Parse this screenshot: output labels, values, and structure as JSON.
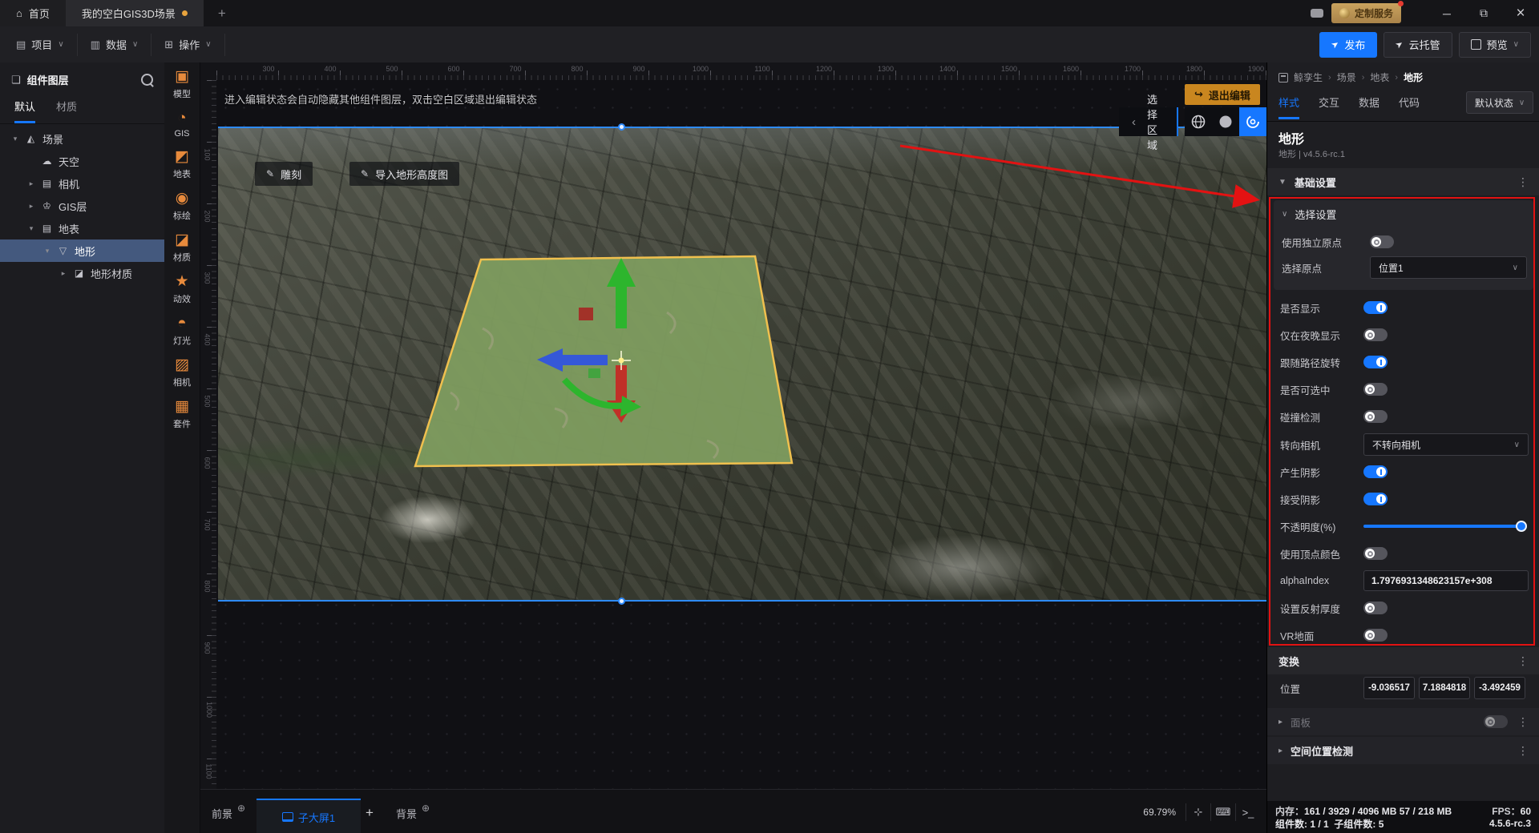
{
  "colors": {
    "accent": "#1677ff",
    "dock_icon": "#e78a3c",
    "annotation": "#e31212",
    "exit_button": "#c9861f",
    "tab_dot": "#e8a33d"
  },
  "titlebar": {
    "home_tab": "首页",
    "doc_tab": "我的空白GIS3D场景",
    "add_tab": "+",
    "service_badge": "定制服务",
    "minimize": "─",
    "restore": "⧉",
    "close": "×"
  },
  "menubar": {
    "items": [
      {
        "name": "project",
        "label": "项目"
      },
      {
        "name": "data",
        "label": "数据"
      },
      {
        "name": "operate",
        "label": "操作"
      }
    ],
    "publish": "发布",
    "cloud_host": "云托管",
    "preview": "预览"
  },
  "sidebar": {
    "title": "组件图层",
    "tabs": [
      {
        "name": "default",
        "label": "默认",
        "active": true
      },
      {
        "name": "material",
        "label": "材质",
        "active": false
      }
    ],
    "tree": [
      {
        "name": "scene",
        "label": "场景",
        "icon": "scene",
        "caret": "open",
        "indent": 0,
        "selected": false
      },
      {
        "name": "sky",
        "label": "天空",
        "icon": "sky",
        "caret": "",
        "indent": 1,
        "selected": false
      },
      {
        "name": "camera",
        "label": "相机",
        "icon": "folder",
        "caret": "closed",
        "indent": 1,
        "selected": false
      },
      {
        "name": "gis-layer",
        "label": "GIS层",
        "icon": "gis",
        "caret": "closed",
        "indent": 1,
        "selected": false
      },
      {
        "name": "ground",
        "label": "地表",
        "icon": "folder",
        "caret": "open",
        "indent": 1,
        "selected": false
      },
      {
        "name": "terrain",
        "label": "地形",
        "icon": "terrain",
        "caret": "open",
        "indent": 2,
        "selected": true
      },
      {
        "name": "terrain-material",
        "label": "地形材质",
        "icon": "material",
        "caret": "closed",
        "indent": 3,
        "selected": false
      }
    ]
  },
  "dock": {
    "items": [
      {
        "name": "model",
        "label": "模型"
      },
      {
        "name": "gis",
        "label": "GIS"
      },
      {
        "name": "ground",
        "label": "地表"
      },
      {
        "name": "plot",
        "label": "标绘"
      },
      {
        "name": "material",
        "label": "材质"
      },
      {
        "name": "effect",
        "label": "动效"
      },
      {
        "name": "light",
        "label": "灯光"
      },
      {
        "name": "camera",
        "label": "相机"
      },
      {
        "name": "kit",
        "label": "套件"
      }
    ]
  },
  "viewport": {
    "notice": "进入编辑状态会自动隐藏其他组件图层，双击空白区域退出编辑状态",
    "exit_edit": "退出编辑",
    "sculpt": "雕刻",
    "import_heightmap": "导入地形高度图",
    "select_region": "选择区域",
    "h_ruler": [
      "300",
      "400",
      "500",
      "600",
      "700",
      "800",
      "900",
      "1000",
      "1100",
      "1200",
      "1300",
      "1400",
      "1500",
      "1600",
      "1700",
      "1800",
      "1900"
    ],
    "v_ruler": [
      "100",
      "200",
      "300",
      "400",
      "500",
      "600",
      "700",
      "800",
      "900",
      "1000",
      "1100"
    ]
  },
  "bottombar": {
    "foreground_tab": "前景",
    "screen_tab": "子大屏1",
    "add_tab": "+",
    "background_tab": "背景",
    "zoom": "69.79%"
  },
  "inspector": {
    "breadcrumb": [
      "鲸孪生",
      "场景",
      "地表",
      "地形"
    ],
    "tabs": [
      {
        "name": "style",
        "label": "样式",
        "active": true
      },
      {
        "name": "interaction",
        "label": "交互",
        "active": false
      },
      {
        "name": "data",
        "label": "数据",
        "active": false
      },
      {
        "name": "code",
        "label": "代码",
        "active": false
      }
    ],
    "state_selector": "默认状态",
    "title": "地形",
    "subtitle": "地形 | v4.5.6-rc.1",
    "base_section": "基础设置",
    "select_group": {
      "title": "选择设置",
      "rows": [
        {
          "name": "use-independent-origin",
          "label": "使用独立原点",
          "type": "toggle",
          "value": false
        },
        {
          "name": "select-origin",
          "label": "选择原点",
          "type": "select",
          "value": "位置1"
        }
      ]
    },
    "rows": [
      {
        "name": "visible",
        "label": "是否显示",
        "type": "toggle",
        "value": true
      },
      {
        "name": "night-only",
        "label": "仅在夜晚显示",
        "type": "toggle",
        "value": false
      },
      {
        "name": "follow-path-rotation",
        "label": "跟随路径旋转",
        "type": "toggle",
        "value": true
      },
      {
        "name": "selectable",
        "label": "是否可选中",
        "type": "toggle",
        "value": false
      },
      {
        "name": "collision-detection",
        "label": "碰撞检测",
        "type": "toggle",
        "value": false
      },
      {
        "name": "face-camera",
        "label": "转向相机",
        "type": "select",
        "value": "不转向相机"
      },
      {
        "name": "cast-shadow",
        "label": "产生阴影",
        "type": "toggle",
        "value": true
      },
      {
        "name": "receive-shadow",
        "label": "接受阴影",
        "type": "toggle",
        "value": true
      },
      {
        "name": "opacity",
        "label": "不透明度(%)",
        "type": "slider",
        "value": 100
      },
      {
        "name": "vertex-color",
        "label": "使用顶点颜色",
        "type": "toggle",
        "value": false
      },
      {
        "name": "alpha-index",
        "label": "alphaIndex",
        "type": "input",
        "value": "1.7976931348623157e+308"
      },
      {
        "name": "reflection-thickness",
        "label": "设置反射厚度",
        "type": "toggle",
        "value": false
      },
      {
        "name": "vr-ground",
        "label": "VR地面",
        "type": "toggle",
        "value": false
      }
    ],
    "transform_section": "变换",
    "position_label": "位置",
    "position": [
      "-9.036517",
      "7.1884818",
      "-3.492459"
    ],
    "panel_section": "面板",
    "space_section": "空间位置检测"
  },
  "statusbar": {
    "memory_label": "内存：",
    "memory_value": "161 / 3929 / 4096 MB  57 / 218 MB",
    "fps_label": "FPS：",
    "fps_value": "60",
    "components": "组件数: 1 / 1",
    "sub_components": "子组件数: 5",
    "version": "4.5.6-rc.3"
  }
}
